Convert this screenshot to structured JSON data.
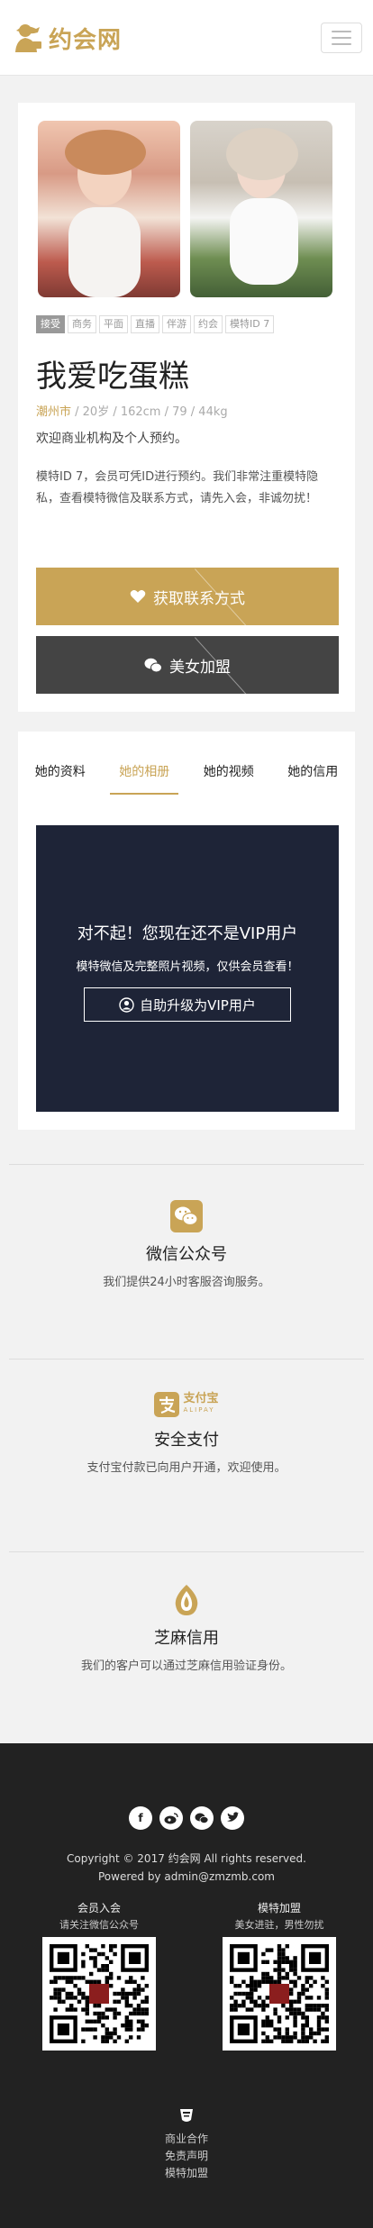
{
  "header": {
    "logo_text": "约会网"
  },
  "profile": {
    "tags": [
      "接受",
      "商务",
      "平面",
      "直播",
      "伴游",
      "约会",
      "模特ID 7"
    ],
    "name": "我爱吃蛋糕",
    "city": "潮州市",
    "details": " / 20岁 / 162cm / 79 / 44kg",
    "intro": "欢迎商业机构及个人预约。",
    "description": "模特ID 7，会员可凭ID进行预约。我们非常注重模特隐私，查看模特微信及联系方式，请先入会，非诚勿扰！",
    "contact_button": "获取联系方式",
    "join_button": "美女加盟"
  },
  "album": {
    "tabs": [
      "她的资料",
      "她的相册",
      "她的视频",
      "她的信用"
    ],
    "active_tab": "她的相册",
    "vip_title": "对不起！您现在还不是VIP用户",
    "vip_subtitle": "模特微信及完整照片视频，仅供会员查看！",
    "vip_button": "自助升级为VIP用户"
  },
  "features": {
    "wechat": {
      "title": "微信公众号",
      "desc": "我们提供24小时客服咨询服务。"
    },
    "alipay": {
      "title": "安全支付",
      "desc": "支付宝付款已向用户开通，欢迎使用。",
      "logo_main": "支付宝",
      "logo_sub": "ALIPAY"
    },
    "sesame": {
      "title": "芝麻信用",
      "desc": "我们的客户可以通过芝麻信用验证身份。"
    }
  },
  "footer": {
    "social_icons": [
      "facebook-icon",
      "weibo-icon",
      "wechat-icon",
      "twitter-icon"
    ],
    "copyright": "Copyright © 2017 约会网 All rights reserved.",
    "powered": "Powered by admin@zmzmb.com",
    "qr_left": {
      "title": "会员入会",
      "sub": "请关注微信公众号"
    },
    "qr_right": {
      "title": "模特加盟",
      "sub": "美女进驻，男性勿扰"
    },
    "links": [
      "商业合作",
      "免责声明",
      "模特加盟"
    ]
  },
  "colors": {
    "accent": "#c9a456",
    "dark_button": "#444444",
    "vip_bg": "#1e2437",
    "footer_bg": "#222222"
  }
}
